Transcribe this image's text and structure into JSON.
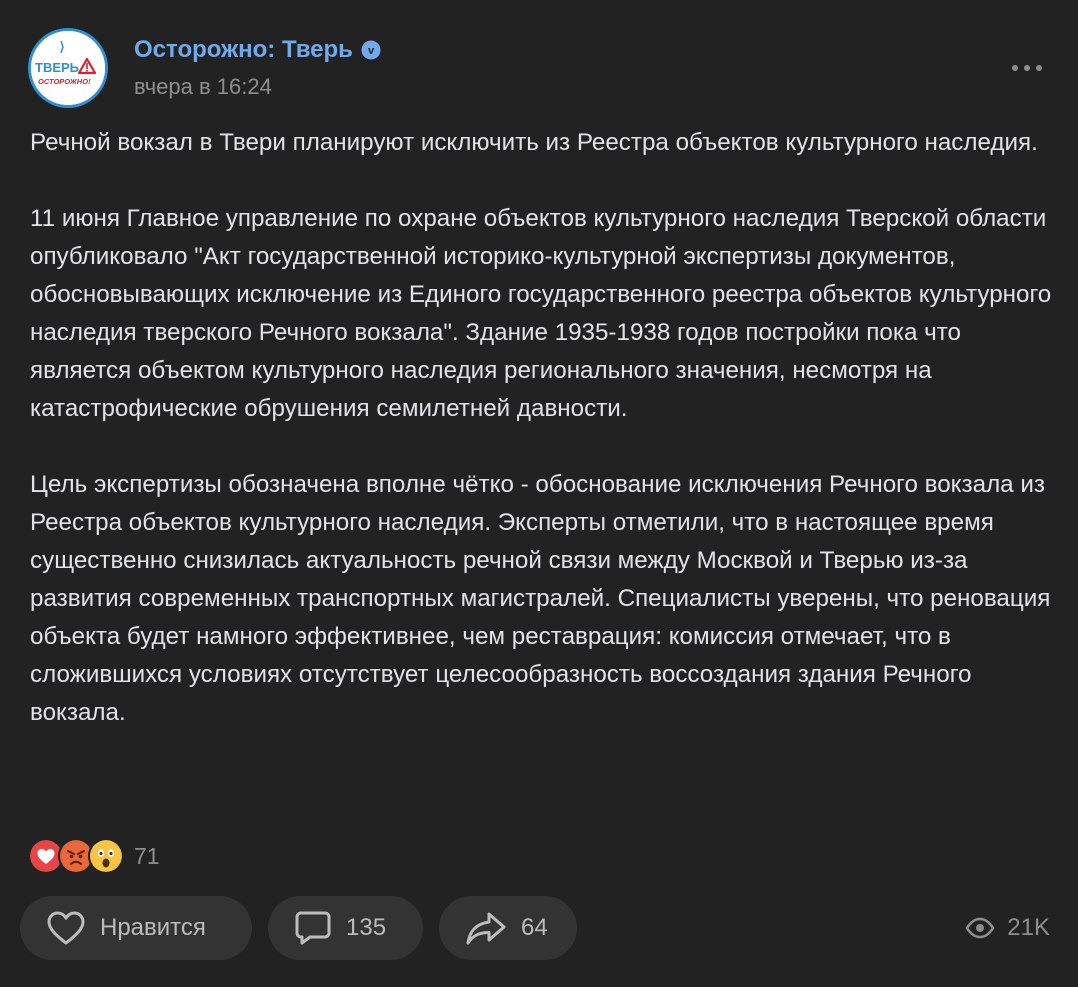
{
  "post": {
    "author": "Осторожно: Тверь",
    "verified_badge": "v",
    "timestamp": "вчера в 16:24",
    "avatar": {
      "line1": "ТВЕРЬ",
      "line2": "ОСТОРОЖНО!",
      "icon": "warning-triangle"
    },
    "paragraphs": [
      "Речной вокзал в Твери планируют исключить из Реестра объектов культурного наследия.",
      "11 июня Главное управление по охране объектов культурного наследия Тверской области опубликовало \"Акт государственной историко-культурной экспертизы документов, обосновывающих исключение из Единого государственного реестра объектов культурного наследия тверского Речного вокзала\". Здание 1935-1938 годов постройки пока что является объектом культурного наследия регионального значения, несмотря на катастрофические обрушения семилетней давности.",
      "Цель экспертизы обозначена вполне чётко - обоснование исключения Речного вокзала из Реестра объектов культурного наследия. Эксперты отметили, что в настоящее время существенно снизилась актуальность речной связи между Москвой и Тверью из-за развития современных транспортных магистралей. Специалисты уверены, что реновация объекта будет намного эффективнее, чем реставрация: комиссия отмечает, что в сложившихся условиях отсутствует целесообразность воссоздания здания Речного вокзала."
    ],
    "reactions": {
      "icons": [
        "heart",
        "angry-face",
        "surprised-face"
      ],
      "count": "71"
    },
    "actions": {
      "like_label": "Нравится",
      "comments_count": "135",
      "shares_count": "64"
    },
    "views": "21K"
  },
  "colors": {
    "background": "#222222",
    "author": "#71aaeb",
    "text": "#e1e3e6",
    "muted": "#8e8e8e",
    "button_bg": "#333333"
  }
}
